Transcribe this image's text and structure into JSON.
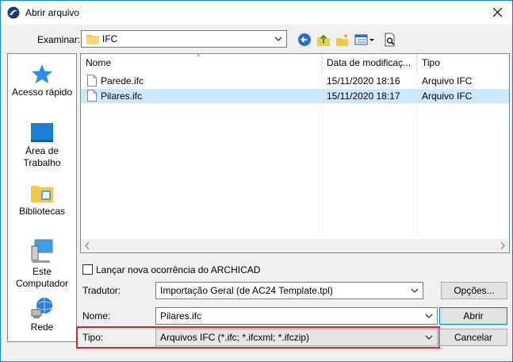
{
  "window": {
    "title": "Abrir arquivo",
    "accent_color": "#1883d7"
  },
  "location": {
    "label": "Examinar:",
    "value": "IFC"
  },
  "places": [
    {
      "label": "Acesso rápido",
      "icon": "star-icon"
    },
    {
      "label": "Área de Trabalho",
      "icon": "desktop-icon"
    },
    {
      "label": "Bibliotecas",
      "icon": "libraries-icon"
    },
    {
      "label": "Este Computador",
      "icon": "computer-icon"
    },
    {
      "label": "Rede",
      "icon": "network-icon"
    }
  ],
  "columns": {
    "name": "Nome",
    "date": "Data de modificaç...",
    "type": "Tipo"
  },
  "files": [
    {
      "name": "Parede.ifc",
      "date": "15/11/2020 18:16",
      "type": "Arquivo IFC",
      "selected": false
    },
    {
      "name": "Pilares.ifc",
      "date": "15/11/2020 18:17",
      "type": "Arquivo IFC",
      "selected": true
    }
  ],
  "options": {
    "new_instance_label": "Lançar nova ocorrência do ARCHICAD",
    "new_instance_checked": false,
    "translator_label": "Tradutor:",
    "translator_value": "Importação Geral (de AC24 Template.tpl)",
    "options_button": "Opções...",
    "name_label": "Nome:",
    "name_value": "Pilares.ifc",
    "type_label": "Tipo:",
    "type_value": "Arquivos IFC (*.ifc; *.ifcxml; *.ifczip)",
    "open_button": "Abrir",
    "cancel_button": "Cancelar"
  },
  "highlight_color": "#e0242a",
  "selection_color": "#cce8ff"
}
